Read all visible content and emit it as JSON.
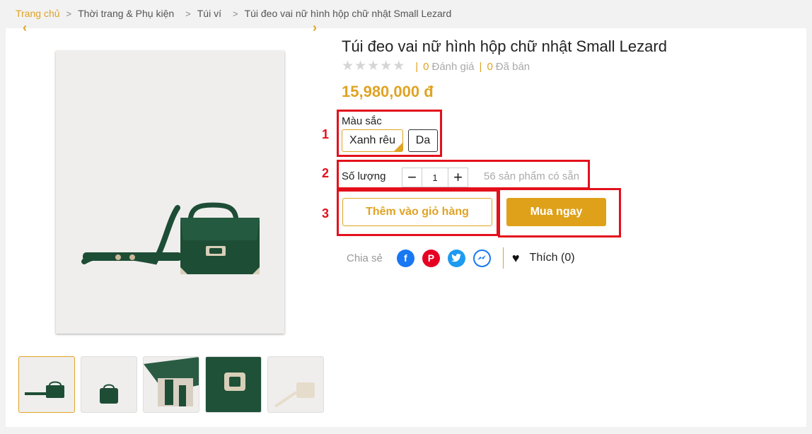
{
  "breadcrumb": {
    "items": [
      "Trang chủ",
      "Thời trang & Phụ kiện",
      "Túi ví",
      "Túi đeo vai nữ hình hộp chữ nhật Small Lezard"
    ],
    "separator": ">"
  },
  "product": {
    "title": "Túi đeo vai nữ hình hộp chữ nhật Small Lezard",
    "rating_stars": 5,
    "reviews_count": "0",
    "reviews_label": "Đánh giá",
    "sold_count": "0",
    "sold_label": "Đã bán",
    "rating_divider": "|",
    "price": "15,980,000 đ"
  },
  "color_option": {
    "label": "Màu sắc",
    "options": [
      "Xanh rêu",
      "Da"
    ],
    "selected": "Xanh rêu"
  },
  "quantity": {
    "label": "Số lượng",
    "value": "1",
    "minus": "−",
    "plus": "+",
    "stock_text": "56 sản phẩm có sẵn"
  },
  "actions": {
    "add_to_cart": "Thêm vào giỏ hàng",
    "buy_now": "Mua ngay"
  },
  "share": {
    "label": "Chia sẻ",
    "like_text": "Thích (0)",
    "icons": [
      "facebook-icon",
      "pinterest-icon",
      "twitter-icon",
      "messenger-icon"
    ]
  },
  "annotations": {
    "labels": [
      "1",
      "2",
      "3"
    ],
    "color": "#e3101c"
  },
  "gallery": {
    "thumb_count": 5,
    "prev": "‹",
    "next": "›"
  },
  "colors": {
    "accent": "#e0a324",
    "buy_button": "#dfa119",
    "bag_green": "#1e4d36"
  }
}
